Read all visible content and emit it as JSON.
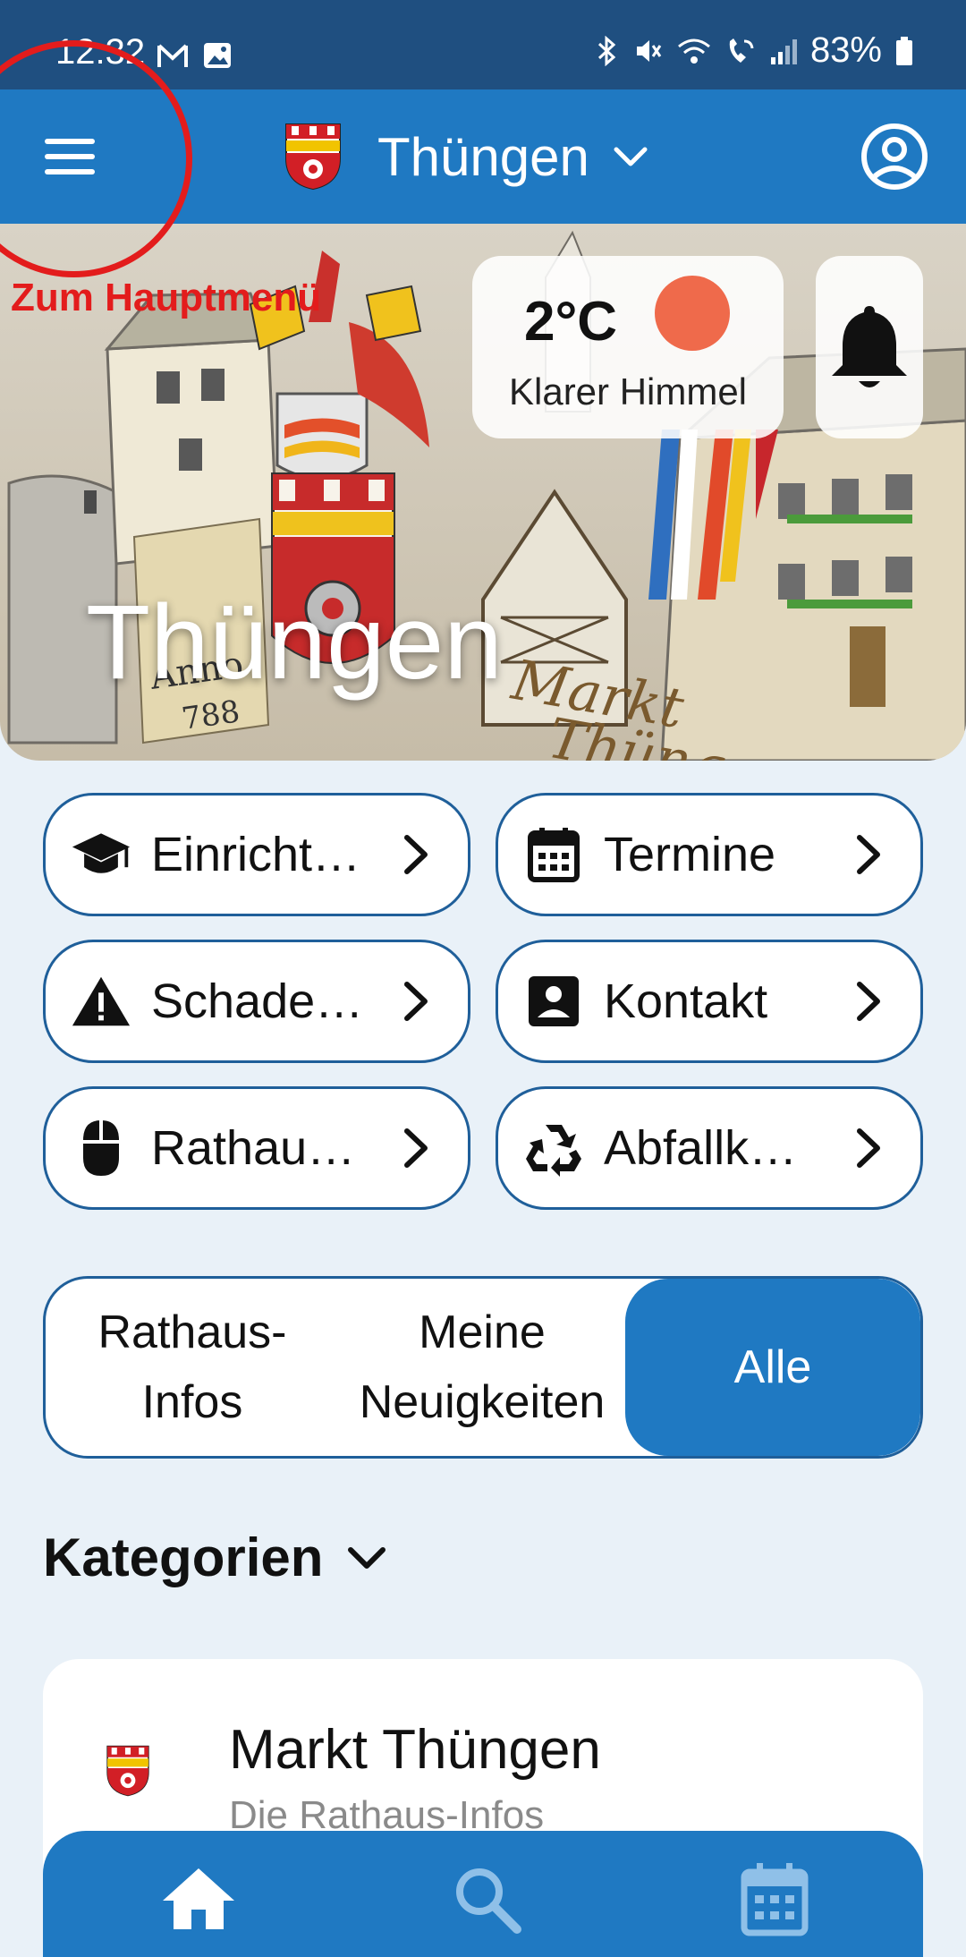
{
  "status_bar": {
    "time": "12:32",
    "battery": "83%",
    "icons": [
      "gmail-icon",
      "gallery-icon",
      "bluetooth-icon",
      "mute-icon",
      "wifi-icon",
      "wifi-call-icon",
      "signal-icon",
      "battery-icon"
    ]
  },
  "header": {
    "town_name": "Thüngen",
    "menu_icon": "hamburger-menu-icon",
    "profile_icon": "account-circle-icon",
    "accent": "#1f79c2"
  },
  "annotation": {
    "label": "Zum Hauptmenü",
    "color": "#e31c1c"
  },
  "hero": {
    "title": "Thüngen"
  },
  "weather": {
    "temperature": "2°C",
    "description": "Klarer Himmel"
  },
  "quick_links": [
    {
      "label": "Einricht…",
      "icon": "graduation-cap-icon"
    },
    {
      "label": "Termine",
      "icon": "calendar-icon"
    },
    {
      "label": "Schade…",
      "icon": "warning-icon"
    },
    {
      "label": "Kontakt",
      "icon": "contact-card-icon"
    },
    {
      "label": "Rathau…",
      "icon": "mouse-icon"
    },
    {
      "label": "Abfallk…",
      "icon": "recycle-icon"
    }
  ],
  "segments": {
    "rathaus_line1": "Rathaus-",
    "rathaus_line2": "Infos",
    "news_line1": "Meine",
    "news_line2": "Neuigkeiten",
    "all": "Alle",
    "selected": "Alle"
  },
  "categories": {
    "title": "Kategorien"
  },
  "card": {
    "title": "Markt Thüngen",
    "subtitle": "Die Rathaus-Infos"
  },
  "bottom_nav": {
    "items": [
      "home-icon",
      "search-icon",
      "calendar-icon"
    ]
  }
}
